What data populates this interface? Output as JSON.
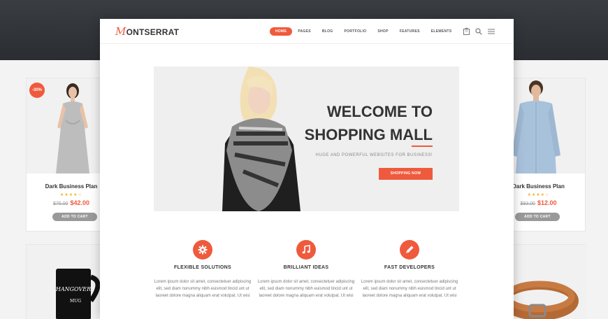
{
  "colors": {
    "accent": "#ef5a3d",
    "dark": "#2e3135",
    "cart_button": "#999999"
  },
  "site": {
    "logo_initial": "M",
    "logo_rest": "ONTSERRAT",
    "nav": [
      "HOME",
      "PAGES",
      "BLOG",
      "PORTFOLIO",
      "SHOP",
      "FEATURES",
      "ELEMENTS"
    ],
    "active_nav": "HOME",
    "cart_count": "0",
    "icons": [
      "cart-icon",
      "search-icon",
      "menu-icon"
    ]
  },
  "hero": {
    "title_line1": "WELCOME TO",
    "title_line2": "SHOPPING MALL",
    "subtitle": "HUGE AND POWERFUL WEBSITES FOR BUSINESS!",
    "button": "SHOPPING NOW"
  },
  "features": [
    {
      "icon": "gear-icon",
      "title": "FLEXIBLE SOLUTIONS",
      "line1": "Lorem ipsum dolor sit amet, consectetuer adipiscing",
      "line2": "elit, sed diam nonummy nibh euismod tincid unt ut",
      "line3": "laoreet dolore magna aliquam erat volutpat. Ut wisi"
    },
    {
      "icon": "music-note-icon",
      "title": "BRILLIANT IDEAS",
      "line1": "Lorem ipsum dolor sit amet, consectetuer adipiscing",
      "line2": "elit, sed diam nonummy nibh euismod tincid unt ut",
      "line3": "laoreet dolore magna aliquam erat volutpat. Ut wisi"
    },
    {
      "icon": "pencil-icon",
      "title": "FAST DEVELOPERS",
      "line1": "Lorem ipsum dolor sit amet, consectetuer adipiscing",
      "line2": "elit, sed diam nonummy nibh euismod tincid unt ut",
      "line3": "laoreet dolore magna aliquam erat volutpat. Ut wisi"
    }
  ],
  "products": {
    "left": {
      "badge": "-30%",
      "name": "Dark Business Plan",
      "stars": "★★★★☆",
      "old_price": "$75.00",
      "new_price": "$42.00",
      "button": "ADD TO CART"
    },
    "right": {
      "name": "Dark Business Plan",
      "stars": "★★★★☆",
      "old_price": "$93.00",
      "new_price": "$12.00",
      "button": "ADD TO CART"
    }
  }
}
